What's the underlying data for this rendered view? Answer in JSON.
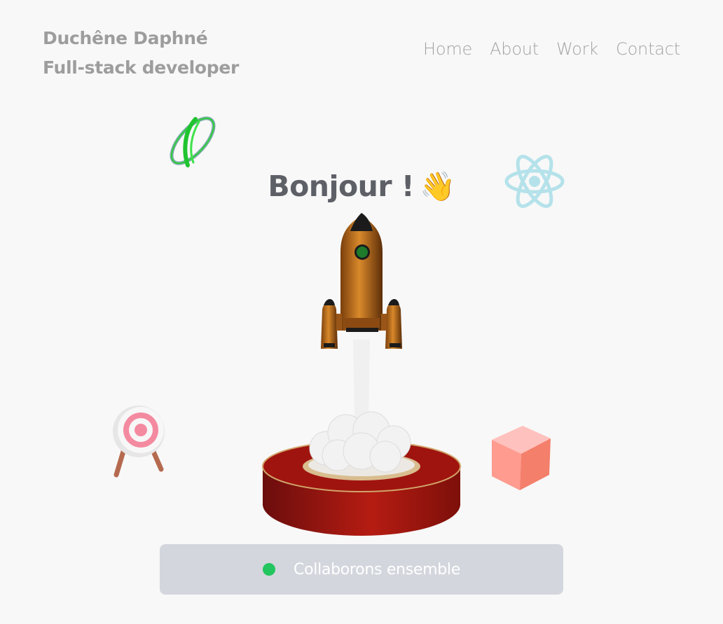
{
  "header": {
    "name": "Duchêne Daphné",
    "role": "Full-stack developer"
  },
  "nav": {
    "items": [
      "Home",
      "About",
      "Work",
      "Contact"
    ]
  },
  "hero": {
    "greeting": "Bonjour !",
    "emoji": "👋",
    "cta_label": "Collaborons ensemble",
    "cta_dot_color": "#22c55e"
  },
  "icons": [
    "ring-icon",
    "react-atom-icon",
    "target-icon",
    "cube-icon",
    "rocket-icon"
  ]
}
